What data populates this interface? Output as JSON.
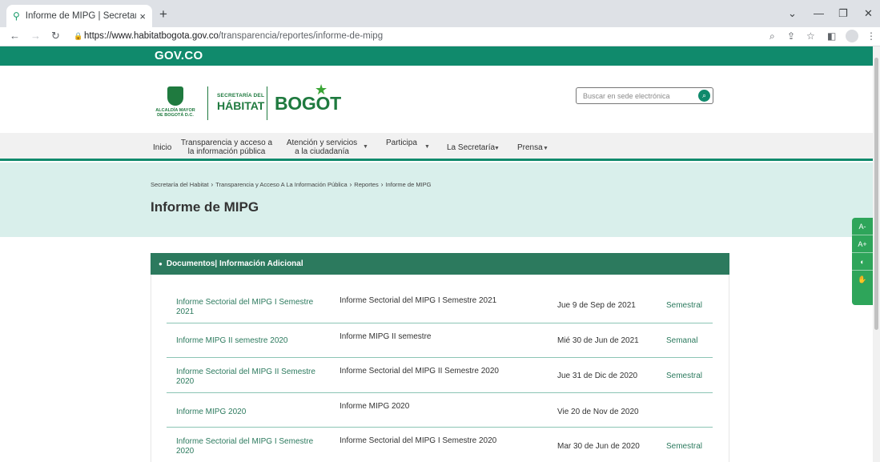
{
  "browser": {
    "tab_title": "Informe de MIPG | Secretaría del",
    "tab_close": "×",
    "new_tab": "+",
    "url_host": "https://www.habitatbogota.gov.co",
    "url_path": "/transparencia/reportes/informe-de-mipg"
  },
  "gov": {
    "label": "GOV.CO"
  },
  "header": {
    "alcaldia": "ALCALDÍA MAYOR DE BOGOTÁ D.C.",
    "sec_small": "SECRETARÍA DEL",
    "sec_big": "HÁBITAT",
    "bogota": "BOGOT"
  },
  "search": {
    "placeholder": "Buscar en sede electrónica"
  },
  "menu": {
    "inicio": "Inicio",
    "transparencia": "Transparencia y acceso a la información pública",
    "atencion": "Atención y servicios a la ciudadanía",
    "participa": "Participa",
    "secretaria": "La Secretaría",
    "prensa": "Prensa"
  },
  "breadcrumb": {
    "b1": "Secretaría del Habitat",
    "b2": "Transparencia y Acceso A La Información Pública",
    "b3": "Reportes",
    "b4": "Informe de MIPG"
  },
  "page_title": "Informe de MIPG",
  "a11y": {
    "decrease": "A-",
    "increase": "A+"
  },
  "panel": {
    "title": "Documentos| Información Adicional"
  },
  "documents": [
    {
      "title": "Informe Sectorial del MIPG I Semestre 2021",
      "description": "Informe Sectorial del MIPG I Semestre 2021",
      "date": "Jue 9 de Sep de 2021",
      "frequency": "Semestral"
    },
    {
      "title": "Informe MIPG II semestre 2020",
      "description": "Informe MIPG II semestre",
      "date": "Mié 30 de Jun de 2021",
      "frequency": "Semanal"
    },
    {
      "title": "Informe Sectorial del MIPG II Semestre 2020",
      "description": "Informe Sectorial del MIPG II Semestre 2020",
      "date": "Jue 31 de Dic de 2020",
      "frequency": "Semestral"
    },
    {
      "title": "Informe MIPG 2020",
      "description": "Informe MIPG 2020",
      "date": "Vie 20 de Nov de 2020",
      "frequency": ""
    },
    {
      "title": "Informe Sectorial del MIPG I Semestre 2020",
      "description": "Informe Sectorial del MIPG I Semestre 2020",
      "date": "Mar 30 de Jun de 2020",
      "frequency": "Semestral"
    }
  ],
  "colors": {
    "brand_green": "#108a6c",
    "hero_bg": "#d9efeb",
    "panel_head": "#2c7a5e",
    "a11y_green": "#2ea55a"
  }
}
